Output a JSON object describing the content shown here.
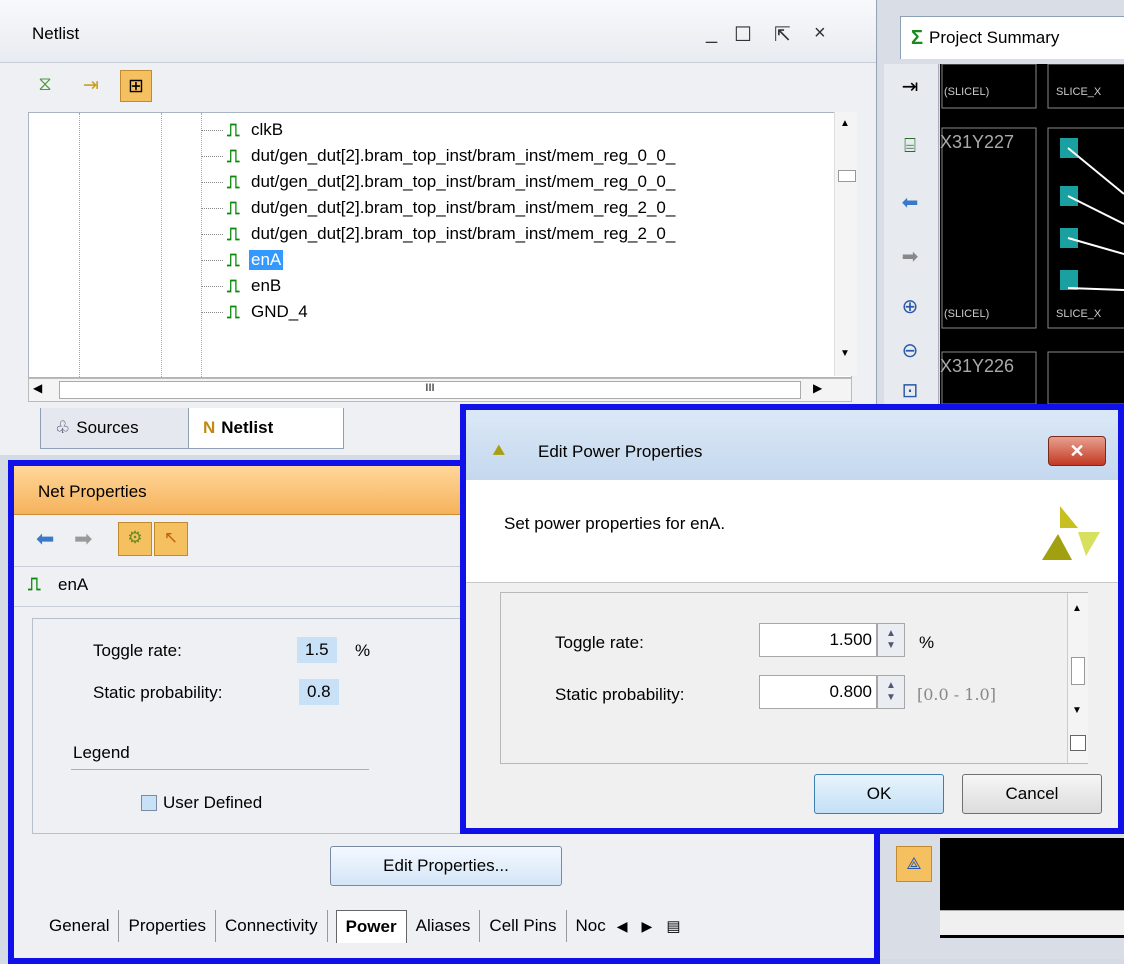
{
  "netlist": {
    "title": "Netlist",
    "window_buttons": [
      "_",
      "☐",
      "⇱",
      "×"
    ],
    "nets": [
      {
        "label": "clkB",
        "selected": false
      },
      {
        "label": "dut/gen_dut[2].bram_top_inst/bram_inst/mem_reg_0_0_",
        "selected": false
      },
      {
        "label": "dut/gen_dut[2].bram_top_inst/bram_inst/mem_reg_0_0_",
        "selected": false
      },
      {
        "label": "dut/gen_dut[2].bram_top_inst/bram_inst/mem_reg_2_0_",
        "selected": false
      },
      {
        "label": "dut/gen_dut[2].bram_top_inst/bram_inst/mem_reg_2_0_",
        "selected": false
      },
      {
        "label": "enA",
        "selected": true
      },
      {
        "label": "enB",
        "selected": false
      },
      {
        "label": "GND_4",
        "selected": false
      }
    ],
    "hscroll_thumb": "III",
    "tabs": [
      {
        "label": "Sources",
        "icon": "sources-icon",
        "active": false
      },
      {
        "label": "Netlist",
        "icon": "netlist-icon",
        "active": true
      }
    ]
  },
  "project": {
    "tab_label": "Project Summary",
    "device_labels": [
      "(SLICEL)",
      "SLICE_X",
      "X31Y227",
      "(SLICEL)",
      "SLICE_X",
      "X31Y226"
    ]
  },
  "net_properties": {
    "title": "Net Properties",
    "net_name": "enA",
    "toggle_rate_label": "Toggle rate:",
    "toggle_rate_value": "1.5",
    "toggle_rate_unit": "%",
    "static_prob_label": "Static probability:",
    "static_prob_value": "0.8",
    "legend_label": "Legend",
    "legend_item": "User Defined",
    "edit_button": "Edit Properties...",
    "tabs": [
      "General",
      "Properties",
      "Connectivity",
      "Power",
      "Aliases",
      "Cell Pins",
      "Noc"
    ],
    "active_tab": "Power"
  },
  "dialog": {
    "title": "Edit Power Properties",
    "close_label": "✕",
    "description": "Set power properties for enA.",
    "toggle_rate_label": "Toggle rate:",
    "toggle_rate_value": "1.500",
    "toggle_rate_unit": "%",
    "static_prob_label": "Static probability:",
    "static_prob_value": "0.800",
    "static_prob_range": "[0.0 - 1.0]",
    "ok_label": "OK",
    "cancel_label": "Cancel"
  },
  "colors": {
    "selection": "#3399ff",
    "highlight_border": "#1010e8",
    "net_properties_header": "#f6b25c",
    "value_highlight": "#c9e1f7"
  }
}
